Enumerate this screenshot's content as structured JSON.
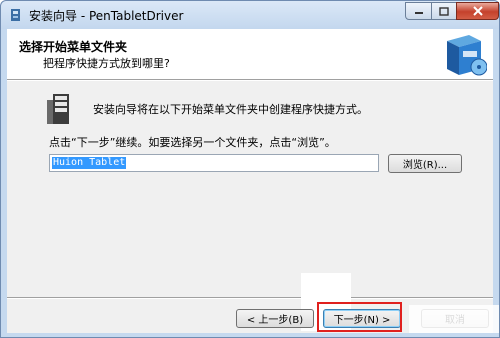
{
  "window": {
    "title": "安装向导 - PenTabletDriver",
    "controls": {
      "minimize": "minimize",
      "maximize": "maximize",
      "close": "close"
    }
  },
  "header": {
    "title": "选择开始菜单文件夹",
    "subtitle": "把程序快捷方式放到哪里?"
  },
  "body": {
    "info": "安装向导将在以下开始菜单文件夹中创建程序快捷方式。",
    "instruction": "点击“下一步”继续。如要选择另一个文件夹，点击“浏览”。",
    "folder_value": "Huion Tablet",
    "browse_label": "浏览(R)..."
  },
  "footer": {
    "back_label": "< 上一步(B)",
    "next_label": "下一步(N) >",
    "cancel_label": "取消"
  },
  "colors": {
    "highlight": "#e0201e",
    "selection": "#3399ff"
  }
}
